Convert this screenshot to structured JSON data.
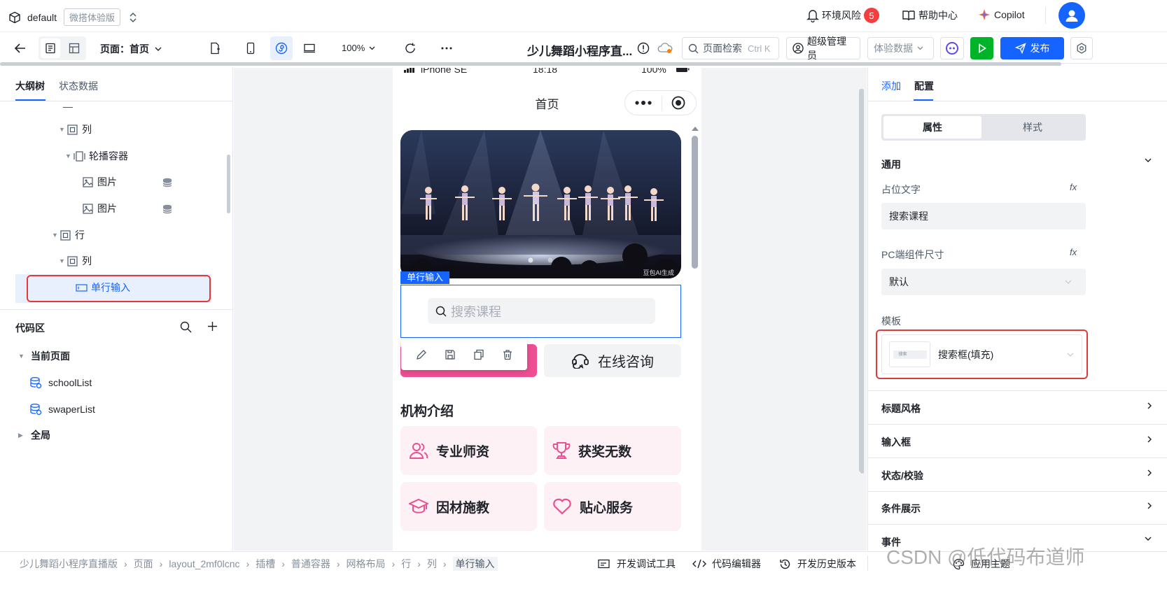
{
  "topbar": {
    "workspace": "default",
    "edition_badge": "微搭体验版",
    "env_risk_label": "环境风险",
    "env_risk_count": "5",
    "help_label": "帮助中心",
    "copilot_label": "Copilot"
  },
  "toolbar": {
    "page_label": "页面：首页",
    "zoom": "100%",
    "app_title": "少儿舞蹈小程序直...",
    "search_label": "页面检索",
    "search_shortcut": "Ctrl K",
    "admin_label": "超级管理员",
    "data_label": "体验数据",
    "publish_label": "发布"
  },
  "left": {
    "tabs": [
      "大纲树",
      "状态数据"
    ],
    "tree": [
      {
        "label": "列"
      },
      {
        "label": "轮播容器"
      },
      {
        "label": "图片"
      },
      {
        "label": "图片"
      },
      {
        "label": "行"
      },
      {
        "label": "列"
      },
      {
        "label": "单行输入"
      }
    ],
    "code_area": {
      "title": "代码区",
      "current_page": "当前页面",
      "items": [
        "schoolList",
        "swaperList"
      ],
      "global": "全局"
    }
  },
  "phone": {
    "status_device": "iPhone SE",
    "status_time": "18:18",
    "status_battery": "100%",
    "nav_title": "首页",
    "image_watermark": "豆包AI生成",
    "selected_tag": "单行输入",
    "search_placeholder": "搜索课程",
    "consult_label": "在线咨询",
    "section_title": "机构介绍",
    "features": [
      "专业师资",
      "获奖无数",
      "因材施教",
      "贴心服务"
    ],
    "accent_color": "#ec4f92"
  },
  "right": {
    "tabs": [
      "添加",
      "配置"
    ],
    "subtabs": [
      "属性",
      "样式"
    ],
    "general_label": "通用",
    "placeholder_label": "占位文字",
    "placeholder_value": "搜索课程",
    "pc_size_label": "PC端组件尺寸",
    "pc_size_value": "默认",
    "template_label": "模板",
    "template_value": "搜索框(填充)",
    "template_thumb_text": "搜索",
    "sections": [
      "标题风格",
      "输入框",
      "状态/校验",
      "条件展示",
      "事件"
    ],
    "fx": "fx"
  },
  "bottom": {
    "breadcrumb": [
      "少儿舞蹈小程序直播版",
      "页面",
      "layout_2mf0lcnc",
      "插槽",
      "普通容器",
      "网格布局",
      "行",
      "列",
      "单行输入"
    ],
    "dev_tools": "开发调试工具",
    "code_editor": "代码编辑器",
    "history": "开发历史版本",
    "theme": "应用主题",
    "watermark": "CSDN @低代码布道师"
  }
}
